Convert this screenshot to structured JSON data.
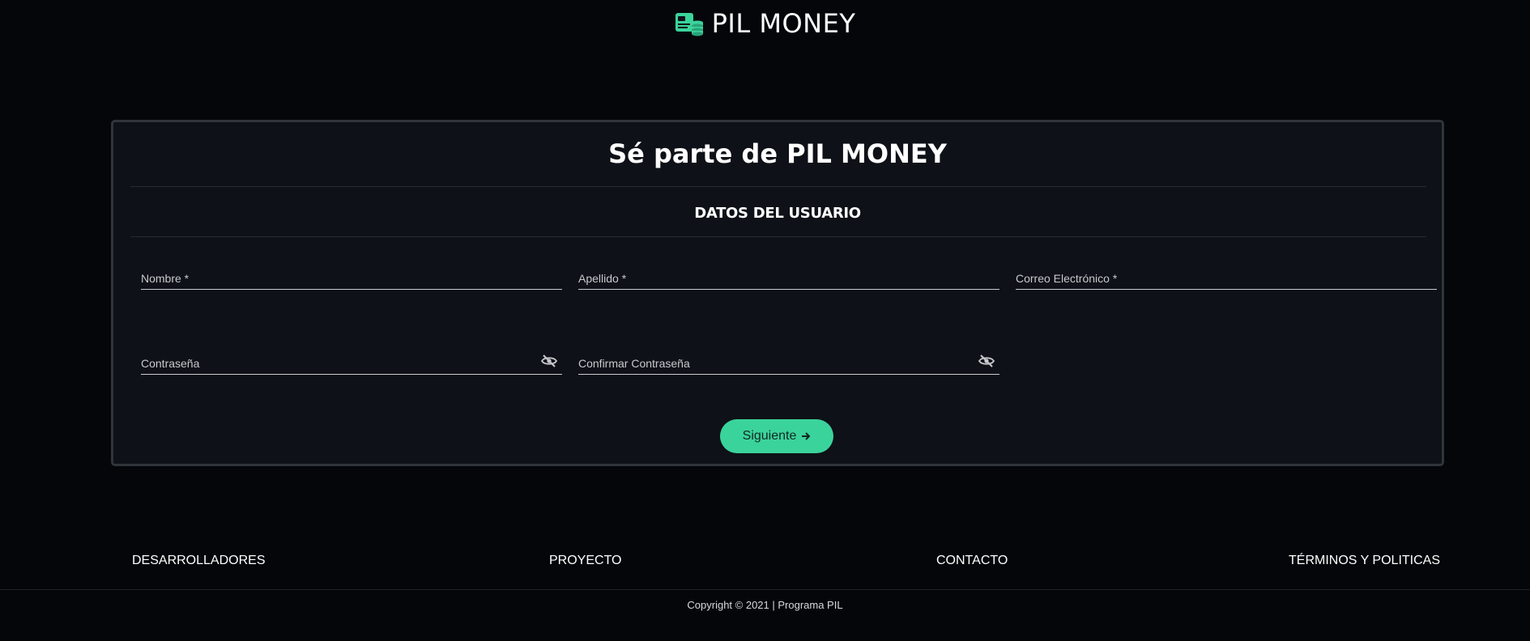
{
  "header": {
    "brand_name": "PIL MONEY",
    "logo_icon": "money-stack-icon",
    "accent_color": "#3bd39c"
  },
  "card": {
    "title": "Sé parte de PIL MONEY",
    "section_title": "DATOS DEL USUARIO",
    "fields": {
      "first_name": {
        "label": "Nombre *",
        "value": ""
      },
      "last_name": {
        "label": "Apellido *",
        "value": ""
      },
      "email": {
        "label": "Correo Electrónico *",
        "value": ""
      },
      "password": {
        "label": "Contraseña",
        "value": "",
        "icon": "eye-slash-icon"
      },
      "confirm_password": {
        "label": "Confirmar Contraseña",
        "value": "",
        "icon": "eye-slash-icon"
      }
    },
    "next_button": {
      "label": "Siguiente",
      "icon": "arrow-right-icon"
    }
  },
  "footer": {
    "links": [
      "DESARROLLADORES",
      "PROYECTO",
      "CONTACTO",
      "TÉRMINOS Y POLITICAS"
    ],
    "copyright": "Copyright © 2021 | Programa PIL"
  }
}
